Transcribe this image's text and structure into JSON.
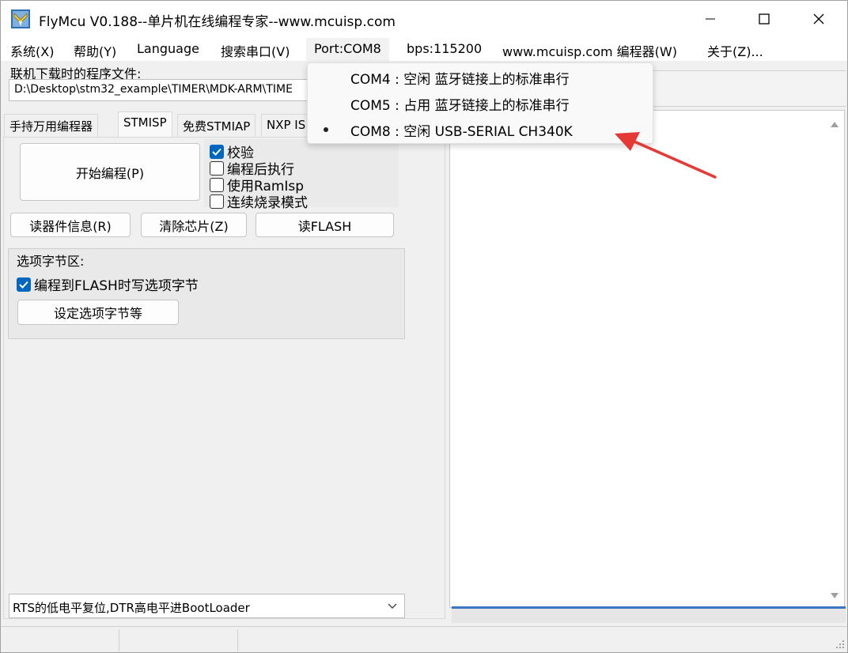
{
  "window": {
    "title": "FlyMcu V0.188--单片机在线编程专家--www.mcuisp.com"
  },
  "menu": {
    "items": [
      "系统(X)",
      "帮助(Y)",
      "Language",
      "搜索串口(V)",
      "Port:COM8",
      "bps:115200",
      "www.mcuisp.com 编程器(W)",
      "关于(Z)..."
    ]
  },
  "file": {
    "label": "联机下载时的程序文件:",
    "path": "D:\\Desktop\\stm32_example\\TIMER\\MDK-ARM\\TIME"
  },
  "tabs": [
    "手持万用编程器",
    "STMISP",
    "免费STMIAP",
    "NXP IS"
  ],
  "actions": {
    "start": "开始编程(P)",
    "read_info": "读器件信息(R)",
    "erase": "清除芯片(Z)",
    "read_flash": "读FLASH"
  },
  "checkboxes": [
    {
      "label": "校验",
      "checked": true
    },
    {
      "label": "编程后执行",
      "checked": false
    },
    {
      "label": "使用RamIsp",
      "checked": false
    },
    {
      "label": "连续烧录模式",
      "checked": false
    }
  ],
  "option_bytes": {
    "title": "选项字节区:",
    "write_label": "编程到FLASH时写选项字节",
    "write_checked": true,
    "set_button": "设定选项字节等"
  },
  "boot_mode": {
    "selected": "RTS的低电平复位,DTR高电平进BootLoader"
  },
  "port_dropdown": {
    "items": [
      {
        "label": "COM4 : 空闲 蓝牙链接上的标准串行",
        "selected": false
      },
      {
        "label": "COM5 : 占用 蓝牙链接上的标准串行",
        "selected": false
      },
      {
        "label": "COM8 : 空闲 USB-SERIAL CH340K",
        "selected": true
      }
    ]
  },
  "colors": {
    "accent": "#0067c0",
    "annotation_arrow": "#e53935",
    "progress_line": "#3a76c4"
  }
}
